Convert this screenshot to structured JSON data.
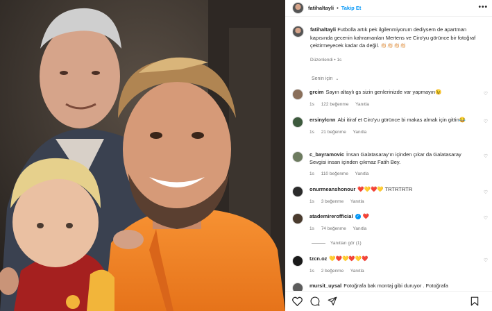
{
  "post": {
    "username": "fatihaltayli",
    "follow_label": "Takip Et",
    "more_label": "•••",
    "separator": "•",
    "caption": "Futbolla artık pek ilgilenmiyorum dediysem de apartman kapısında gecenin kahramanları Mertens ve Ciro'yu görünce bir fotoğraf çektirmeyecek kadar da değil. 👏🏻👏🏻👏🏻👏🏻",
    "edited": "Düzenlendi",
    "age": "1s"
  },
  "sort": {
    "label": "Senin için",
    "chevron": "⌄"
  },
  "comments": [
    {
      "user": "grcim",
      "text": "Sayın altaylı gs sizin genlerinizde var yapmayın😉",
      "time": "1s",
      "likes": "122 beğenme",
      "reply": "Yanıtla",
      "avatar_color": "#8a6f5a"
    },
    {
      "user": "ersinylcnn",
      "text": "Abi itiraf et Ciro'yu görünce bi makas almak için gittin😂",
      "time": "1s",
      "likes": "21 beğenme",
      "reply": "Yanıtla",
      "avatar_color": "#3d5a3d"
    },
    {
      "user": "c_bayramovic",
      "text": "İnsan Galatasaray'ın içinden çıkar da Galatasaray Sevgisi insan içinden çıkmaz Fatih Bey.",
      "time": "1s",
      "likes": "110 beğenme",
      "reply": "Yanıtla",
      "avatar_color": "#6d7b5f"
    },
    {
      "user": "onurmeanshonour",
      "text": "❤️💛❤️💛 TRTRTRTR",
      "time": "1s",
      "likes": "3 beğenme",
      "reply": "Yanıtla",
      "avatar_color": "#2b2b2b"
    },
    {
      "user": "atademirerofficial",
      "text": "❤️",
      "time": "1s",
      "likes": "74 beğenme",
      "reply": "Yanıtla",
      "avatar_color": "#4a3b2e"
    },
    {
      "user": "tzcn.oz",
      "text": "💛❤️💛❤️💛❤️",
      "time": "1s",
      "likes": "2 beğenme",
      "reply": "Yanıtla",
      "avatar_color": "#1a1a1a"
    },
    {
      "user": "mursit_uysal",
      "text": "Fotoğrafa bak montaj gibi duruyor . Fotoğrafa",
      "time": "",
      "likes": "",
      "reply": "",
      "avatar_color": "#5c5c5c"
    }
  ],
  "view_replies": "Yanıtları gör (1)",
  "colors": {
    "accent": "#0095f6",
    "muted": "#737373",
    "verified": "#0095f6"
  }
}
